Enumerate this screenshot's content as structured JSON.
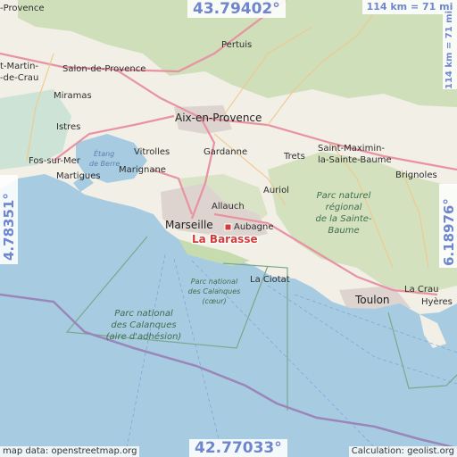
{
  "coordinates": {
    "top": "43.79402°",
    "bottom": "42.77033°",
    "left": "4.78351°",
    "right": "6.18976°"
  },
  "scale": {
    "top": "114 km = 71 mi",
    "right": "114 km = 71 mi"
  },
  "credits": {
    "left": "map data: openstreetmap.org",
    "right": "Calculation: geolist.org"
  },
  "marker": {
    "label": "La Barasse",
    "color": "#d23c3c"
  },
  "places": {
    "provence": "-Provence",
    "st_martin": "t-Martin-",
    "de_crau": "-de-Crau",
    "salon": "Salon-de-Provence",
    "pertuis": "Pertuis",
    "miramas": "Miramas",
    "aix": "Aix-en-Provence",
    "istres": "Istres",
    "vitrolles": "Vitrolles",
    "etang1": "Étang",
    "etang2": "de Berre",
    "marignane": "Marignane",
    "gardanne": "Gardanne",
    "trets": "Trets",
    "stmax1": "Saint-Maximin-",
    "stmax2": "la-Sainte-Baume",
    "fos": "Fos-sur-Mer",
    "martigues": "Martigues",
    "brignoles": "Brignoles",
    "allauch": "Allauch",
    "auriol": "Auriol",
    "pnr1": "Parc naturel",
    "pnr2": "régional",
    "pnr3": "de la Sainte-",
    "pnr4": "Baume",
    "marseille": "Marseille",
    "aubagne": "Aubagne",
    "pnc1": "Parc national",
    "pnc2": "des Calanques",
    "pnc3": "(cœur)",
    "laciotat": "La Ciotat",
    "toulon": "Toulon",
    "lacrau": "La Crau",
    "hyeres": "Hyères",
    "pnca1": "Parc national",
    "pnca2": "des Calanques",
    "pnca3": "(aire d'adhésion)"
  },
  "colors": {
    "land": "#f2efe6",
    "sea": "#a7cce2",
    "forest": "#c7dcae",
    "urban": "#dcd5d0",
    "motorway": "#e892a2",
    "boundary": "#9a86b8",
    "park": "#7aa88a"
  }
}
